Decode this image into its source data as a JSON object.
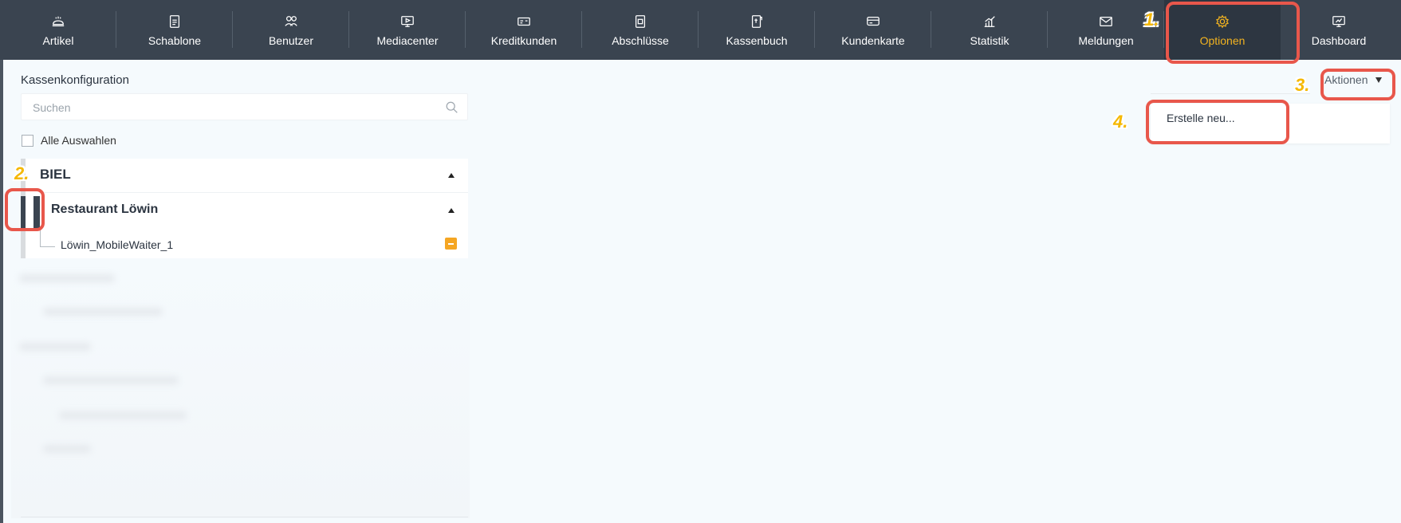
{
  "topnav": {
    "items": [
      {
        "label": "Artikel",
        "icon": "bread-icon"
      },
      {
        "label": "Schablone",
        "icon": "document-icon"
      },
      {
        "label": "Benutzer",
        "icon": "users-icon"
      },
      {
        "label": "Mediacenter",
        "icon": "monitor-icon"
      },
      {
        "label": "Kreditkunden",
        "icon": "id-card-icon"
      },
      {
        "label": "Abschlüsse",
        "icon": "report-icon"
      },
      {
        "label": "Kassenbuch",
        "icon": "ledger-icon"
      },
      {
        "label": "Kundenkarte",
        "icon": "card-icon"
      },
      {
        "label": "Statistik",
        "icon": "chart-icon"
      },
      {
        "label": "Meldungen",
        "icon": "mail-icon"
      },
      {
        "label": "Optionen",
        "icon": "gear-icon"
      },
      {
        "label": "Dashboard",
        "icon": "dashboard-icon"
      }
    ],
    "active": "Optionen",
    "active_color": "#f2b320",
    "bg_color": "#3a4450"
  },
  "steps": [
    "1.",
    "2.",
    "3.",
    "4."
  ],
  "left_panel": {
    "title": "Kassenkonfiguration",
    "search_placeholder": "Suchen",
    "select_all": "Alle Auswahlen",
    "tree": {
      "group": "BIEL",
      "subgroup": "Restaurant Löwin",
      "device": "Löwin_MobileWaiter_1"
    }
  },
  "actions": {
    "label": "Aktionen",
    "menu_items": [
      "Erstelle neu..."
    ]
  },
  "annotation_color": "#e8574b"
}
